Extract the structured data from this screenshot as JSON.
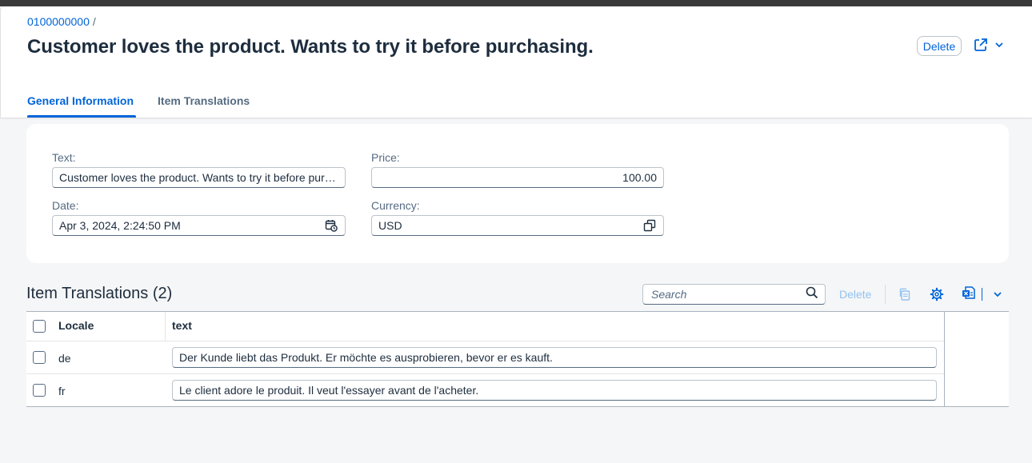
{
  "breadcrumb": {
    "link": "0100000000",
    "separator": "/"
  },
  "header": {
    "title": "Customer loves the product. Wants to try it before purchasing.",
    "delete_label": "Delete"
  },
  "tabs": [
    {
      "label": "General Information",
      "active": true
    },
    {
      "label": "Item Translations",
      "active": false
    }
  ],
  "form": {
    "text_label": "Text:",
    "text_value": "Customer loves the product. Wants to try it before purchasing.",
    "date_label": "Date:",
    "date_value": "Apr 3, 2024, 2:24:50 PM",
    "price_label": "Price:",
    "price_value": "100.00",
    "currency_label": "Currency:",
    "currency_value": "USD"
  },
  "translations": {
    "title": "Item Translations (2)",
    "search_placeholder": "Search",
    "delete_label": "Delete",
    "columns": {
      "locale": "Locale",
      "text": "text"
    },
    "rows": [
      {
        "locale": "de",
        "text": "Der Kunde liebt das Produkt. Er möchte es ausprobieren, bevor er es kauft."
      },
      {
        "locale": "fr",
        "text": "Le client adore le produit. Il veut l'essayer avant de l'acheter."
      }
    ]
  },
  "icons": {
    "share": "share-icon",
    "chevron": "chevron-down-icon",
    "calendar": "calendar-clock-icon",
    "value_help": "value-help-icon",
    "search": "search-icon",
    "copy": "copy-icon",
    "settings": "gear-icon",
    "export": "export-excel-icon"
  },
  "colors": {
    "accent": "#0064d9",
    "disabled_accent": "#94c2f0",
    "text": "#1d2d3e",
    "muted": "#556b82",
    "background": "#f5f6f7"
  }
}
